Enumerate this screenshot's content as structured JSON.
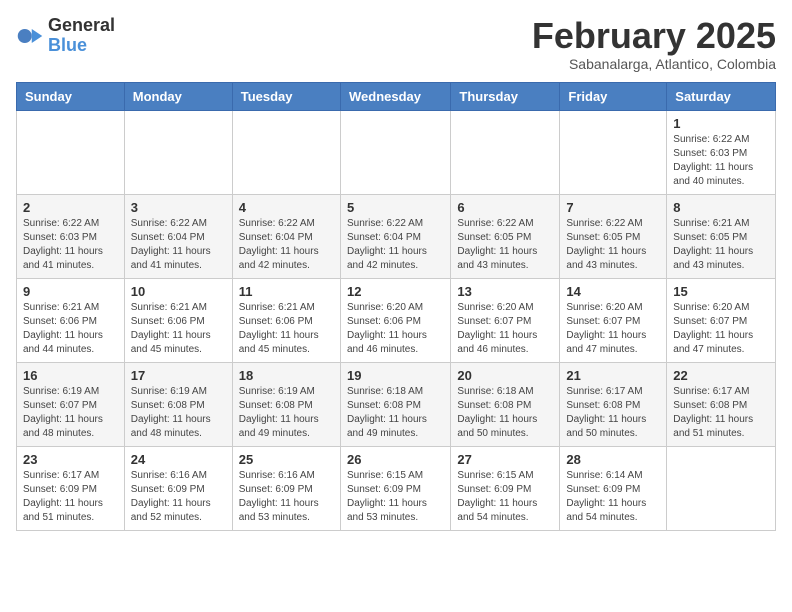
{
  "logo": {
    "general": "General",
    "blue": "Blue"
  },
  "title": "February 2025",
  "location": "Sabanalarga, Atlantico, Colombia",
  "weekdays": [
    "Sunday",
    "Monday",
    "Tuesday",
    "Wednesday",
    "Thursday",
    "Friday",
    "Saturday"
  ],
  "weeks": [
    [
      {
        "day": "",
        "info": ""
      },
      {
        "day": "",
        "info": ""
      },
      {
        "day": "",
        "info": ""
      },
      {
        "day": "",
        "info": ""
      },
      {
        "day": "",
        "info": ""
      },
      {
        "day": "",
        "info": ""
      },
      {
        "day": "1",
        "info": "Sunrise: 6:22 AM\nSunset: 6:03 PM\nDaylight: 11 hours\nand 40 minutes."
      }
    ],
    [
      {
        "day": "2",
        "info": "Sunrise: 6:22 AM\nSunset: 6:03 PM\nDaylight: 11 hours\nand 41 minutes."
      },
      {
        "day": "3",
        "info": "Sunrise: 6:22 AM\nSunset: 6:04 PM\nDaylight: 11 hours\nand 41 minutes."
      },
      {
        "day": "4",
        "info": "Sunrise: 6:22 AM\nSunset: 6:04 PM\nDaylight: 11 hours\nand 42 minutes."
      },
      {
        "day": "5",
        "info": "Sunrise: 6:22 AM\nSunset: 6:04 PM\nDaylight: 11 hours\nand 42 minutes."
      },
      {
        "day": "6",
        "info": "Sunrise: 6:22 AM\nSunset: 6:05 PM\nDaylight: 11 hours\nand 43 minutes."
      },
      {
        "day": "7",
        "info": "Sunrise: 6:22 AM\nSunset: 6:05 PM\nDaylight: 11 hours\nand 43 minutes."
      },
      {
        "day": "8",
        "info": "Sunrise: 6:21 AM\nSunset: 6:05 PM\nDaylight: 11 hours\nand 43 minutes."
      }
    ],
    [
      {
        "day": "9",
        "info": "Sunrise: 6:21 AM\nSunset: 6:06 PM\nDaylight: 11 hours\nand 44 minutes."
      },
      {
        "day": "10",
        "info": "Sunrise: 6:21 AM\nSunset: 6:06 PM\nDaylight: 11 hours\nand 45 minutes."
      },
      {
        "day": "11",
        "info": "Sunrise: 6:21 AM\nSunset: 6:06 PM\nDaylight: 11 hours\nand 45 minutes."
      },
      {
        "day": "12",
        "info": "Sunrise: 6:20 AM\nSunset: 6:06 PM\nDaylight: 11 hours\nand 46 minutes."
      },
      {
        "day": "13",
        "info": "Sunrise: 6:20 AM\nSunset: 6:07 PM\nDaylight: 11 hours\nand 46 minutes."
      },
      {
        "day": "14",
        "info": "Sunrise: 6:20 AM\nSunset: 6:07 PM\nDaylight: 11 hours\nand 47 minutes."
      },
      {
        "day": "15",
        "info": "Sunrise: 6:20 AM\nSunset: 6:07 PM\nDaylight: 11 hours\nand 47 minutes."
      }
    ],
    [
      {
        "day": "16",
        "info": "Sunrise: 6:19 AM\nSunset: 6:07 PM\nDaylight: 11 hours\nand 48 minutes."
      },
      {
        "day": "17",
        "info": "Sunrise: 6:19 AM\nSunset: 6:08 PM\nDaylight: 11 hours\nand 48 minutes."
      },
      {
        "day": "18",
        "info": "Sunrise: 6:19 AM\nSunset: 6:08 PM\nDaylight: 11 hours\nand 49 minutes."
      },
      {
        "day": "19",
        "info": "Sunrise: 6:18 AM\nSunset: 6:08 PM\nDaylight: 11 hours\nand 49 minutes."
      },
      {
        "day": "20",
        "info": "Sunrise: 6:18 AM\nSunset: 6:08 PM\nDaylight: 11 hours\nand 50 minutes."
      },
      {
        "day": "21",
        "info": "Sunrise: 6:17 AM\nSunset: 6:08 PM\nDaylight: 11 hours\nand 50 minutes."
      },
      {
        "day": "22",
        "info": "Sunrise: 6:17 AM\nSunset: 6:08 PM\nDaylight: 11 hours\nand 51 minutes."
      }
    ],
    [
      {
        "day": "23",
        "info": "Sunrise: 6:17 AM\nSunset: 6:09 PM\nDaylight: 11 hours\nand 51 minutes."
      },
      {
        "day": "24",
        "info": "Sunrise: 6:16 AM\nSunset: 6:09 PM\nDaylight: 11 hours\nand 52 minutes."
      },
      {
        "day": "25",
        "info": "Sunrise: 6:16 AM\nSunset: 6:09 PM\nDaylight: 11 hours\nand 53 minutes."
      },
      {
        "day": "26",
        "info": "Sunrise: 6:15 AM\nSunset: 6:09 PM\nDaylight: 11 hours\nand 53 minutes."
      },
      {
        "day": "27",
        "info": "Sunrise: 6:15 AM\nSunset: 6:09 PM\nDaylight: 11 hours\nand 54 minutes."
      },
      {
        "day": "28",
        "info": "Sunrise: 6:14 AM\nSunset: 6:09 PM\nDaylight: 11 hours\nand 54 minutes."
      },
      {
        "day": "",
        "info": ""
      }
    ]
  ]
}
